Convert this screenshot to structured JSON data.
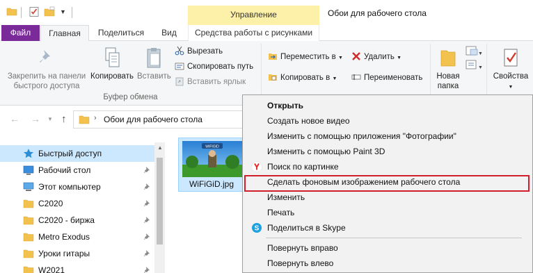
{
  "titlebar": {
    "manage_tab": "Управление",
    "window_title": "Обои для рабочего стола"
  },
  "tabs": {
    "file": "Файл",
    "home": "Главная",
    "share": "Поделиться",
    "view": "Вид",
    "picture_tools": "Средства работы с рисунками"
  },
  "ribbon": {
    "pin_quick_access": [
      "Закрепить на панели",
      "быстрого доступа"
    ],
    "copy": "Копировать",
    "paste": "Вставить",
    "cut": "Вырезать",
    "copy_path": "Скопировать путь",
    "paste_shortcut": "Вставить ярлык",
    "clipboard_group": "Буфер обмена",
    "move_to": "Переместить в",
    "copy_to": "Копировать в",
    "delete": "Удалить",
    "rename": "Переименовать",
    "new_folder": [
      "Новая",
      "папка"
    ],
    "properties": "Свойства"
  },
  "address": {
    "path": "Обои для рабочего стола"
  },
  "navpane": {
    "items": [
      {
        "label": "Быстрый доступ",
        "icon": "star-icon"
      },
      {
        "label": "Рабочий стол",
        "icon": "desktop-icon"
      },
      {
        "label": "Этот компьютер",
        "icon": "computer-icon"
      },
      {
        "label": "C2020",
        "icon": "folder-icon"
      },
      {
        "label": "C2020 - биржа",
        "icon": "folder-icon"
      },
      {
        "label": "Metro Exodus",
        "icon": "folder-icon"
      },
      {
        "label": "Уроки гитары",
        "icon": "folder-icon"
      },
      {
        "label": "W2021",
        "icon": "folder-icon"
      }
    ]
  },
  "file": {
    "name": "WiFiGiD.jpg",
    "thumb_caption": "WIFIGID"
  },
  "context_menu": {
    "items": [
      {
        "label": "Открыть",
        "bold": true
      },
      {
        "label": "Создать новое видео"
      },
      {
        "label": "Изменить с помощью приложения \"Фотографии\""
      },
      {
        "label": "Изменить с помощью Paint 3D"
      },
      {
        "label": "Поиск по картинке",
        "icon": "yandex-icon"
      },
      {
        "label": "Сделать фоновым изображением рабочего стола",
        "highlighted": true
      },
      {
        "label": "Изменить"
      },
      {
        "label": "Печать"
      },
      {
        "label": "Поделиться в Skype",
        "icon": "skype-icon"
      },
      {
        "label": "Повернуть вправо"
      },
      {
        "label": "Повернуть влево"
      }
    ]
  },
  "colors": {
    "file_tab": "#7b2a9a",
    "manage_tab": "#fdf0a8",
    "selection": "#cce8ff",
    "highlight_border": "#d21e2a"
  }
}
